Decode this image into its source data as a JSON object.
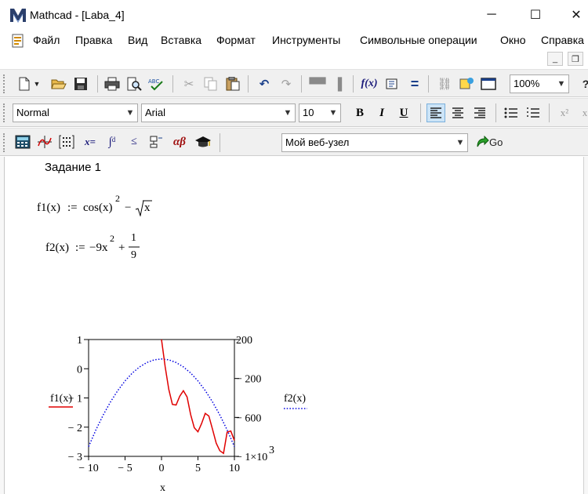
{
  "window": {
    "title": "Mathcad - [Laba_4]",
    "minimize_glyph": "─",
    "maximize_glyph": "☐",
    "close_glyph": "✕"
  },
  "menu": [
    "Файл",
    "Правка",
    "Вид",
    "Вставка",
    "Формат",
    "Инструменты",
    "Символьные операции",
    "Окно",
    "Справка"
  ],
  "toolbar_format": {
    "style": "Normal",
    "font": "Arial",
    "size": "10",
    "bold": "B",
    "italic": "I",
    "underline": "U"
  },
  "toolbar_standard": {
    "zoom": "100%"
  },
  "toolbar_resources": {
    "web": "Мой веб-узел",
    "go": "Go"
  },
  "document": {
    "task_title": "Задание 1",
    "f1": {
      "lhs": "f1(x)",
      "assign": ":=",
      "body": "cos(x)",
      "exp": "2",
      "rest": "−",
      "sqrt_arg": "x"
    },
    "f2": {
      "lhs": "f2(x)",
      "assign": ":=",
      "body": "−9x",
      "exp": "2",
      "plus": "+",
      "num": "1",
      "den": "9"
    }
  },
  "chart_data": {
    "type": "line",
    "xlabel": "x",
    "xlim": [
      -10,
      10
    ],
    "xticks": [
      "− 10",
      "− 5",
      "0",
      "5",
      "10"
    ],
    "left_axis": {
      "label": "f1(x)",
      "ylim": [
        -3,
        1
      ],
      "ticks": [
        "1",
        "0",
        "− 1",
        "− 2",
        "− 3"
      ]
    },
    "right_axis": {
      "label": "f2(x)",
      "ylim": [
        -1000,
        200
      ],
      "ticks": [
        "200",
        "− 200",
        "− 600",
        "− 1×10",
        "3"
      ]
    },
    "series": [
      {
        "name": "f1(x)",
        "axis": "left",
        "style": "solid",
        "color": "#e00000",
        "x": [
          0,
          0.5,
          1,
          1.5,
          2,
          2.5,
          3,
          3.5,
          4,
          4.5,
          5,
          5.5,
          6,
          6.5,
          7,
          7.5,
          8,
          8.5,
          9,
          9.5,
          10
        ],
        "y": [
          1,
          0.063,
          -0.708,
          -1.22,
          -1.241,
          -0.939,
          -0.752,
          -0.966,
          -1.573,
          -2.021,
          -2.156,
          -1.878,
          -1.528,
          -1.621,
          -2.077,
          -2.549,
          -2.807,
          -2.898,
          -2.171,
          -2.132,
          -2.458
        ]
      },
      {
        "name": "f2(x)",
        "axis": "right",
        "style": "dotted",
        "color": "#0000e0",
        "x": [
          -10,
          -9,
          -8,
          -7,
          -6,
          -5,
          -4,
          -3,
          -2,
          -1,
          0,
          1,
          2,
          3,
          4,
          5,
          6,
          7,
          8,
          9,
          10
        ],
        "y": [
          -899.9,
          -728.9,
          -575.9,
          -440.9,
          -323.9,
          -224.9,
          -143.9,
          -80.9,
          -35.9,
          -8.9,
          0.1,
          -8.9,
          -35.9,
          -80.9,
          -143.9,
          -224.9,
          -323.9,
          -440.9,
          -575.9,
          -728.9,
          -899.9
        ]
      }
    ],
    "grid": false
  }
}
